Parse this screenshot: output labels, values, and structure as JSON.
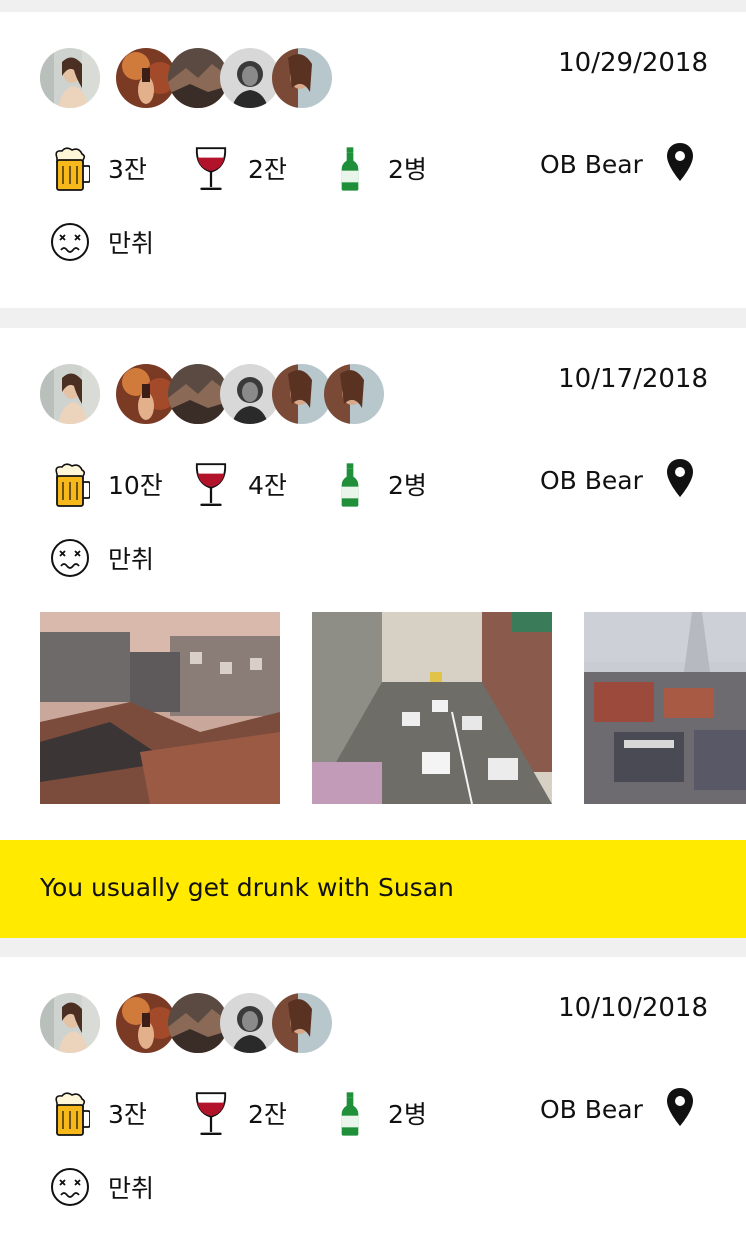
{
  "cards": [
    {
      "date": "10/29/2018",
      "beer": "3잔",
      "wine": "2잔",
      "soju": "2병",
      "place": "OB Bear",
      "status": "만취"
    },
    {
      "date": "10/17/2018",
      "beer": "10잔",
      "wine": "4잔",
      "soju": "2병",
      "place": "OB Bear",
      "status": "만취"
    },
    {
      "date": "10/10/2018",
      "beer": "3잔",
      "wine": "2잔",
      "soju": "2병",
      "place": "OB Bear",
      "status": "만취"
    }
  ],
  "banner": {
    "text": "You usually get drunk with Susan"
  },
  "icons": {
    "beer": "beer-mug-icon",
    "wine": "wine-glass-icon",
    "soju": "soju-bottle-icon",
    "place": "map-pin-icon",
    "drunk": "dizzy-face-icon"
  },
  "colors": {
    "accent_yellow": "#ffea00",
    "background": "#f0f0f0",
    "wine_red": "#b3122b",
    "bottle_green": "#1f8f3a",
    "beer_amber": "#f7b81b"
  }
}
